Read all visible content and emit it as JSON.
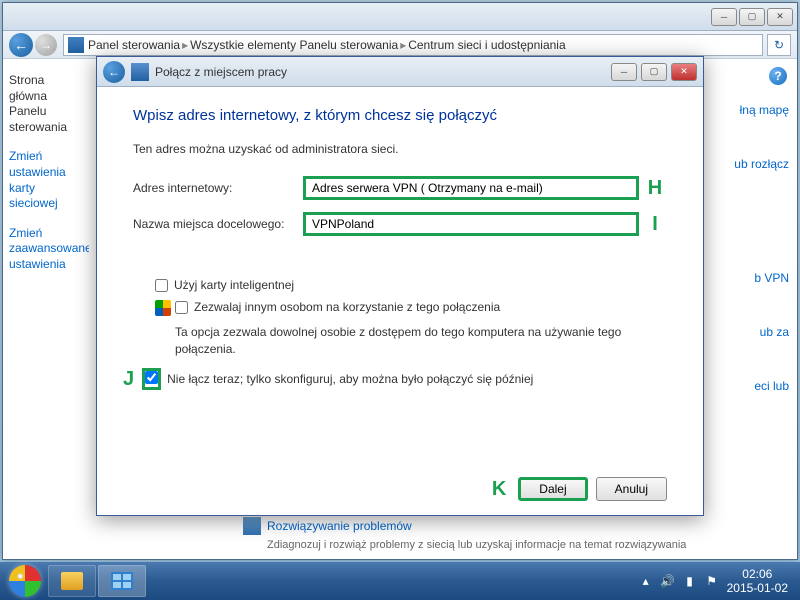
{
  "mainWindow": {
    "breadcrumb": {
      "p1": "Panel sterowania",
      "p2": "Wszystkie elementy Panelu sterowania",
      "p3": "Centrum sieci i udostępniania"
    }
  },
  "sideLinks": {
    "home": "Strona główna Panelu sterowania",
    "adapter": "Zmień ustawienia karty sieciowej",
    "sharing": "Zmień zaawansowane ustawienia"
  },
  "rightLinks": {
    "map": "łną mapę",
    "disconnect": "ub rozłącz",
    "vpn": "b VPN",
    "za": "ub za",
    "lub": "eci lub"
  },
  "bottom": {
    "troubleshoot": "Rozwiązywanie problemów",
    "troubleshootDesc": "Zdiagnozuj i rozwiąż problemy z siecią lub uzyskaj informacje na temat rozwiązywania"
  },
  "dialog": {
    "title": "Połącz z miejscem pracy",
    "heading": "Wpisz adres internetowy, z którym chcesz się połączyć",
    "desc": "Ten adres można uzyskać od administratora sieci.",
    "addressLabel": "Adres internetowy:",
    "addressValue": "Adres serwera VPN ( Otrzymany na e-mail)",
    "nameLabel": "Nazwa miejsca docelowego:",
    "nameValue": "VPNPoland",
    "markerH": "H",
    "markerI": "I",
    "markerJ": "J",
    "markerK": "K",
    "smartcard": "Użyj karty inteligentnej",
    "allowOthers": "Zezwalaj innym osobom na korzystanie z tego połączenia",
    "allowOthersDesc": "Ta opcja zezwala dowolnej osobie z dostępem do tego komputera na używanie tego połączenia.",
    "dontConnect": "Nie łącz teraz; tylko skonfiguruj, aby można było połączyć się później",
    "next": "Dalej",
    "cancel": "Anuluj"
  },
  "taskbar": {
    "time": "02:06",
    "date": "2015-01-02"
  }
}
